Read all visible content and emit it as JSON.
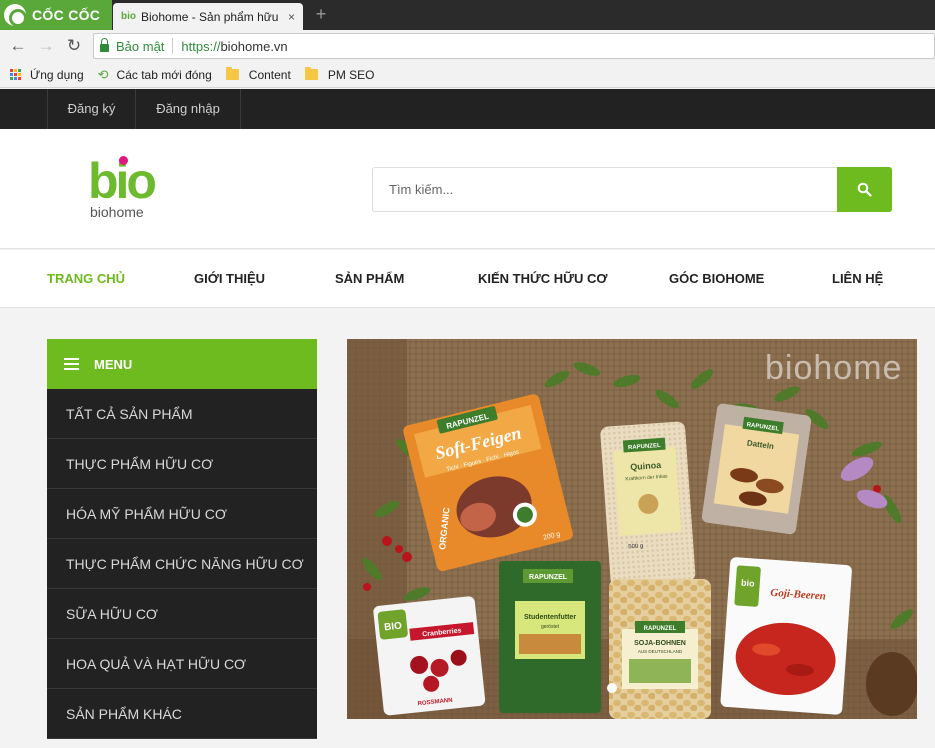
{
  "browser": {
    "brand": "CỐC CỐC",
    "tab_favicon": "bio",
    "tab_title": "Biohome - Sản phẩm hữu",
    "tab_close": "×",
    "new_tab": "+",
    "back": "←",
    "forward": "→",
    "reload": "↻",
    "secure_label": "Bảo mật",
    "url_scheme": "https://",
    "url_host": "biohome.vn",
    "bookmarks": [
      "Ứng dụng",
      "Các tab mới đóng",
      "Content",
      "PM SEO"
    ]
  },
  "topbar": {
    "links": [
      "Đăng ký",
      "Đăng nhập"
    ]
  },
  "logo": {
    "letters": "bio",
    "word": "biohome",
    "dot_color": "#e4167e",
    "green": "#6dba2e"
  },
  "search": {
    "placeholder": "Tìm kiếm...",
    "icon": "search-icon"
  },
  "nav": {
    "items": [
      "TRANG CHỦ",
      "GIỚI THIỆU",
      "SẢN PHẨM",
      "KIẾN THỨC HỮU CƠ",
      "GÓC BIOHOME",
      "LIÊN HỆ"
    ],
    "active_color": "#6dbb1e"
  },
  "menu": {
    "title": "MENU",
    "items": [
      "TẤT CẢ SẢN PHẨM",
      "THỰC PHẨM HỮU CƠ",
      "HÓA MỸ PHẨM HỮU CƠ",
      "THỰC PHẨM CHỨC NĂNG HỮU CƠ",
      "SỮA HỮU CƠ",
      "HOA QUẢ VÀ HẠT HỮU CƠ",
      "SẢN PHẨM KHÁC"
    ]
  },
  "banner": {
    "watermark": "biohome",
    "products": {
      "figs_brand": "RAPUNZEL",
      "figs_name": "Soft-Feigen",
      "figs_sub": "Tichi · Figues · Fichi · Higos",
      "figs_badge": "ORGANIC",
      "figs_weight": "200 g",
      "quinoa_brand": "RAPUNZEL",
      "quinoa_name": "Quinoa",
      "quinoa_sub": "Kraftkorn der Inkas",
      "quinoa_weight": "500 g",
      "dates_brand": "RAPUNZEL",
      "dates_name": "Datteln",
      "cran_brand": "BIO",
      "cran_name": "Cranberries",
      "cran_maker": "ROSSMANN",
      "mix_brand": "RAPUNZEL",
      "mix_name": "Studentenfutter",
      "mix_sub": "geröstet",
      "soy_brand": "RAPUNZEL",
      "soy_name": "SOJA-BOHNEN",
      "soy_sub": "AUS DEUTSCHLAND",
      "goji_brand": "bio",
      "goji_name": "Goji-Beeren"
    }
  }
}
